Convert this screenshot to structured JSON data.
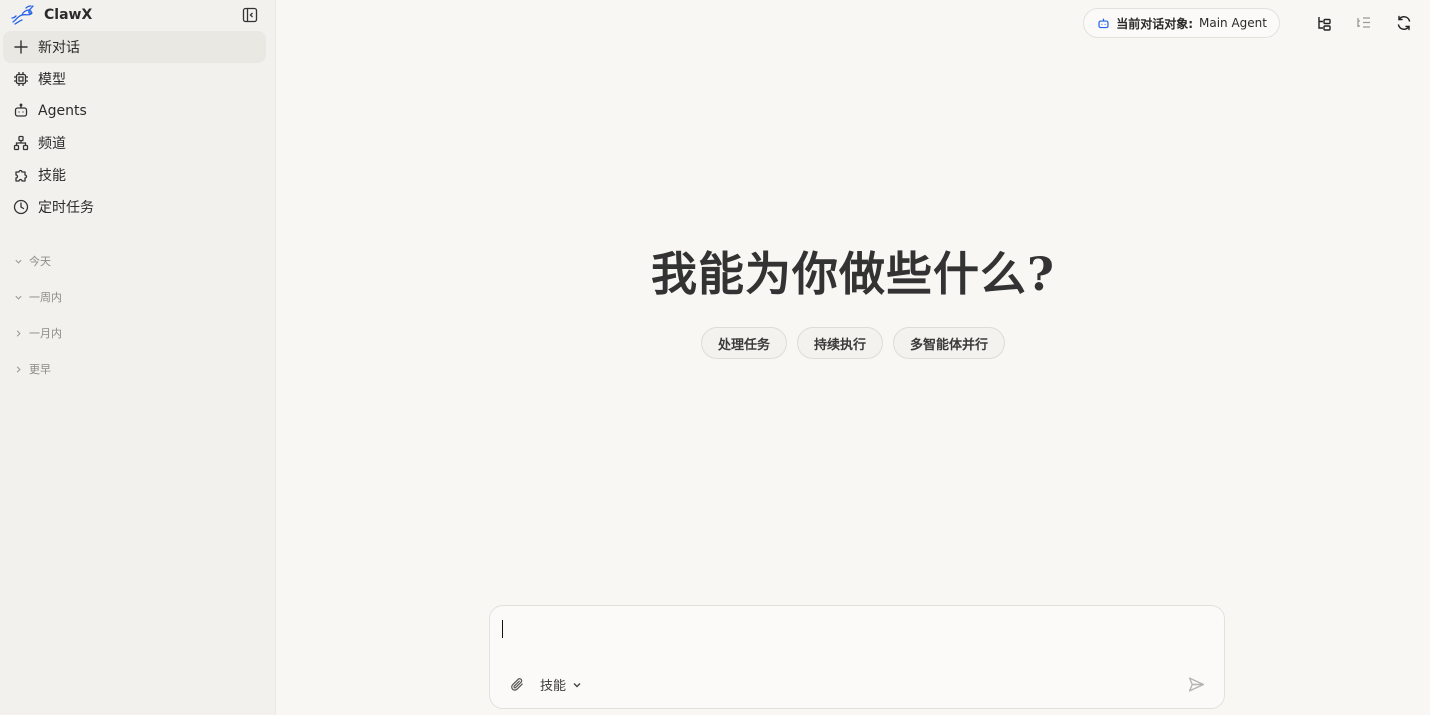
{
  "sidebar": {
    "brand": "ClawX",
    "nav": [
      {
        "label": "新对话",
        "icon": "plus-icon"
      },
      {
        "label": "模型",
        "icon": "chip-icon"
      },
      {
        "label": "Agents",
        "icon": "robot-icon"
      },
      {
        "label": "频道",
        "icon": "network-icon"
      },
      {
        "label": "技能",
        "icon": "puzzle-icon"
      },
      {
        "label": "定时任务",
        "icon": "clock-icon"
      }
    ],
    "groups": [
      {
        "label": "今天",
        "expanded": true
      },
      {
        "label": "一周内",
        "expanded": true
      },
      {
        "label": "一月内",
        "expanded": false
      },
      {
        "label": "更早",
        "expanded": false
      }
    ]
  },
  "topbar": {
    "agent_label": "当前对话对象:",
    "agent_name": "Main Agent"
  },
  "hero": {
    "title": "我能为你做些什么?"
  },
  "chips": [
    "处理任务",
    "持续执行",
    "多智能体并行"
  ],
  "composer": {
    "value": "",
    "skills_label": "技能"
  },
  "colors": {
    "sidebar_bg": "#f2f1ed",
    "main_bg": "#f8f7f4",
    "accent_blue": "#2563eb"
  }
}
